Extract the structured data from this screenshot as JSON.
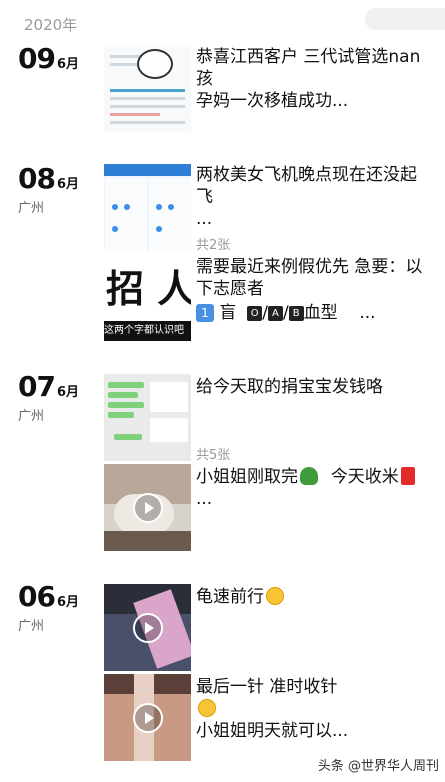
{
  "year": "2020年",
  "sections": [
    {
      "day": "09",
      "month": "6月",
      "city": "",
      "posts": [
        {
          "text": "恭喜江西客户 三代试管选nan孩",
          "text2": "孕妈一次移植成功...",
          "thumb_icon": "document-screenshot-icon"
        }
      ]
    },
    {
      "day": "08",
      "month": "6月",
      "city": "广州",
      "posts": [
        {
          "text": "两枚美女飞机晚点现在还没起飞",
          "text2": "...",
          "count": "共2张",
          "thumb_icon": "app-screenshot-icon"
        },
        {
          "text": "需要最近来例假优先  急要：以下志愿者",
          "line2_prefix": "1",
          "line2_a": "盲",
          "line2_b": "O",
          "line2_c": "A",
          "line2_d": "B",
          "line2_e": "血型",
          "line2_f": "...",
          "big_text": "招 人",
          "strip_text": "这两个字都认识吧",
          "thumb_icon": "recruit-image-icon"
        }
      ]
    },
    {
      "day": "07",
      "month": "6月",
      "city": "广州",
      "posts": [
        {
          "text": "给今天取的捐宝宝发钱咯",
          "count": "共5张",
          "thumb_icon": "chat-screenshot-icon"
        },
        {
          "text": "小姐姐刚取完",
          "text_b": "今天收米",
          "text2": "...",
          "thumb_icon": "video-thumbnail-icon"
        }
      ]
    },
    {
      "day": "06",
      "month": "6月",
      "city": "广州",
      "posts": [
        {
          "text": "龟速前行",
          "thumb_icon": "video-thumbnail-icon"
        },
        {
          "text": "最后一针   准时收针",
          "text2": "小姐姐明天就可以...",
          "thumb_icon": "video-thumbnail-icon"
        }
      ]
    }
  ],
  "watermark": "头条 @世界华人周刊",
  "colors": {
    "accent_blue": "#4a90e2",
    "muted": "#999999"
  }
}
